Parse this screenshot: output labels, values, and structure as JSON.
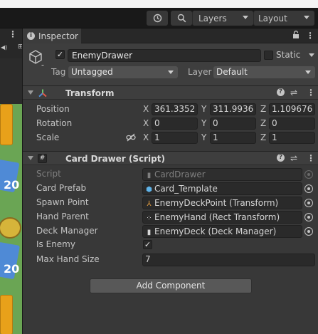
{
  "toolbar": {
    "history_icon": "history-icon",
    "search_icon": "search-icon",
    "layers_label": "Layers",
    "layout_label": "Layout"
  },
  "inspector": {
    "tab_label": "Inspector",
    "gameobject": {
      "active": true,
      "name": "EnemyDrawer",
      "static_label": "Static",
      "static": false,
      "tag_label": "Tag",
      "tag_value": "Untagged",
      "layer_label": "Layer",
      "layer_value": "Default"
    },
    "transform": {
      "title": "Transform",
      "rows": [
        {
          "label": "Position",
          "x": "361.3352",
          "y": "311.9936",
          "z": "1.109676"
        },
        {
          "label": "Rotation",
          "x": "0",
          "y": "0",
          "z": "0"
        },
        {
          "label": "Scale",
          "x": "1",
          "y": "1",
          "z": "1"
        }
      ],
      "axes": [
        "X",
        "Y",
        "Z"
      ]
    },
    "card_drawer": {
      "title": "Card Drawer (Script)",
      "script_label": "Script",
      "script_value": "CardDrawer",
      "card_prefab_label": "Card Prefab",
      "card_prefab_value": "Card_Template",
      "spawn_point_label": "Spawn Point",
      "spawn_point_value": "EnemyDeckPoint (Transform)",
      "hand_parent_label": "Hand Parent",
      "hand_parent_value": "EnemyHand (Rect Transform)",
      "deck_manager_label": "Deck Manager",
      "deck_manager_value": "EnemyDeck (Deck Manager)",
      "is_enemy_label": "Is Enemy",
      "is_enemy": true,
      "max_hand_size_label": "Max Hand Size",
      "max_hand_size_value": "7"
    },
    "add_component_label": "Add Component"
  },
  "scene_preview": {
    "visible_text": [
      "20",
      "20"
    ]
  }
}
